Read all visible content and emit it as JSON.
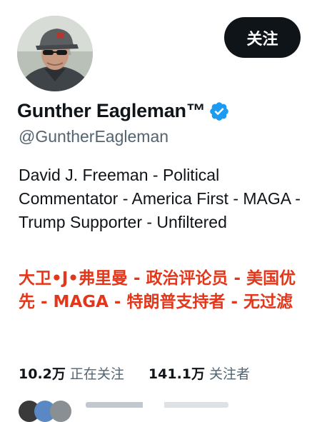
{
  "profile": {
    "display_name": "Gunther Eagleman™",
    "handle": "@GuntherEagleman",
    "verified": true,
    "verified_color": "#1d9bf0",
    "bio": "David J. Freeman - Political Commentator - America First - MAGA - Trump Supporter - Unfiltered",
    "bio_translation": "大卫•J•弗里曼 - 政治评论员 - 美国优先 - MAGA - 特朗普支持者 - 无过滤",
    "translation_color": "#e3361a"
  },
  "actions": {
    "follow_label": "关注"
  },
  "stats": {
    "following_count": "10.2万",
    "following_label": "正在关注",
    "followers_count": "141.1万",
    "followers_label": "关注者"
  },
  "icons": {
    "verified": "verified-badge-icon"
  }
}
